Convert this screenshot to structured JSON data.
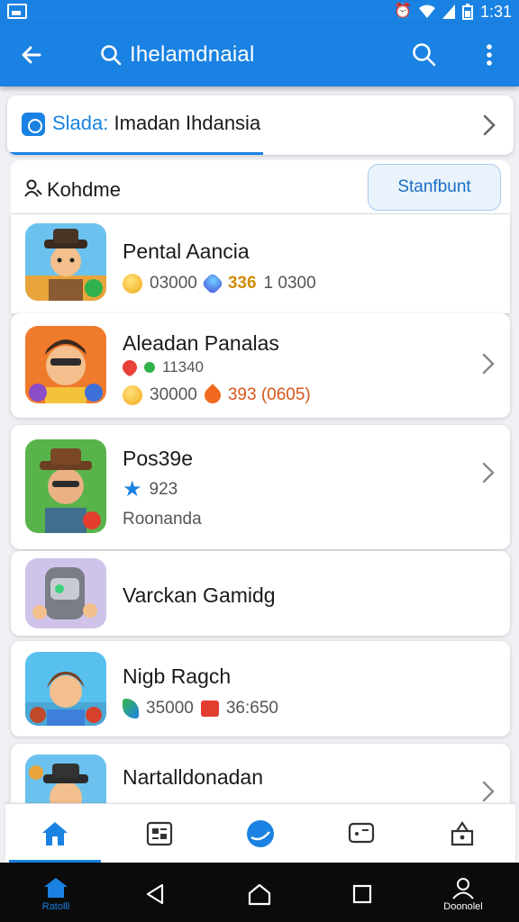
{
  "status_bar": {
    "time": "1:31",
    "icons": [
      "notification-icon",
      "alarm-icon",
      "wifi-icon",
      "signal-icon",
      "battery-icon"
    ]
  },
  "app_bar": {
    "title": "Ihelamdnaial",
    "icons": [
      "back-arrow-icon",
      "search-icon",
      "more-vert-icon"
    ]
  },
  "banner": {
    "label": "Slada:",
    "text": "Imadan Ihdansia"
  },
  "panel": {
    "title": "Kohdme",
    "button": "Stanfbunt"
  },
  "items": [
    {
      "name": "Pental Aancia",
      "stats": [
        {
          "icon": "coin-icon",
          "value": "03000"
        },
        {
          "icon": "gem-icon",
          "value": "336",
          "style": "gold"
        },
        {
          "icon": "",
          "value": "1 0300"
        }
      ]
    },
    {
      "name": "Aleadan Panalas",
      "sub": "11340",
      "stats": [
        {
          "icon": "coin-icon",
          "value": "30000"
        },
        {
          "icon": "flame-icon",
          "value": "393 (0605)",
          "style": "orange"
        }
      ]
    },
    {
      "name": "Pos39e",
      "rating": "923",
      "sub_text": "Roonanda"
    },
    {
      "name": "Varckan Gamidg"
    },
    {
      "name": "Nigb Ragch",
      "stats": [
        {
          "icon": "leaf-icon",
          "value": "35000"
        },
        {
          "icon": "house-icon",
          "value": "36:650"
        }
      ]
    },
    {
      "name": "Nartalldonadan"
    }
  ],
  "bottom_nav": [
    "home-icon",
    "gallery-icon",
    "globe-icon",
    "chat-icon",
    "bag-icon"
  ],
  "system_nav": {
    "left_label": "Ratolll",
    "right_label": "Doonolel"
  },
  "colors": {
    "primary": "#1a82e2",
    "background": "#eef0f3"
  }
}
